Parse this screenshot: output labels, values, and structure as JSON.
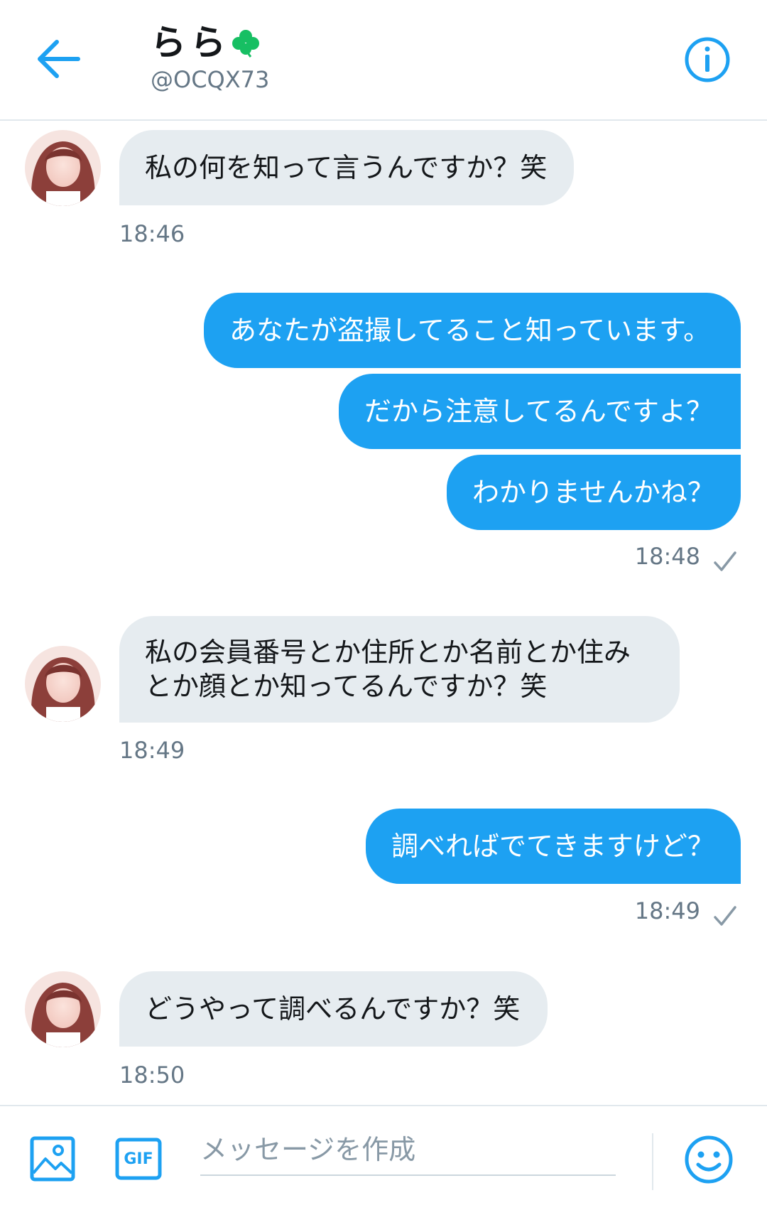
{
  "header": {
    "name": "らら",
    "handle": "@OCQX73"
  },
  "messages": [
    {
      "side": "in",
      "text": "私の何を知って言うんですか？笑",
      "time": "18:46"
    },
    {
      "side": "out",
      "texts": [
        "あなたが盗撮してること知っています。",
        "だから注意してるんですよ？",
        "わかりませんかね？"
      ],
      "time": "18:48"
    },
    {
      "side": "in",
      "text_line1": "私の会員番号とか住所とか名前とか住み",
      "text_line2": "とか顔とか知ってるんですか？笑",
      "time": "18:49"
    },
    {
      "side": "out",
      "texts": [
        "調べればでてきますけど？"
      ],
      "time": "18:49"
    },
    {
      "side": "in",
      "text": "どうやって調べるんですか？笑",
      "time": "18:50"
    }
  ],
  "composer": {
    "placeholder": "メッセージを作成",
    "gif_label": "GIF"
  },
  "colors": {
    "accent": "#1da1f2",
    "incoming_bubble": "#e6ecf0",
    "clover": "#17bf63"
  },
  "icons": [
    "back-arrow-icon",
    "clover-icon",
    "info-icon",
    "check-icon",
    "image-icon",
    "gif-icon",
    "emoji-icon"
  ]
}
